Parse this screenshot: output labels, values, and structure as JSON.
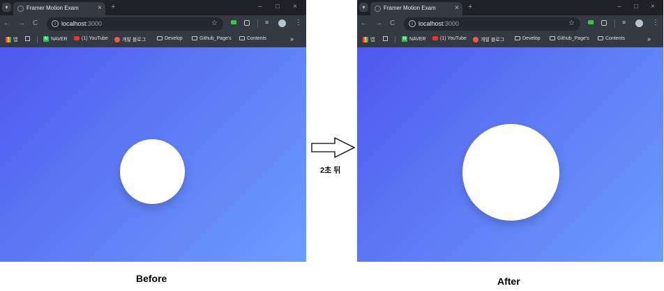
{
  "browser": {
    "tab_title": "Framer Motion Exam",
    "url_host": "localhost",
    "url_port": ":3000",
    "bookmarks": [
      "앱",
      "NAVER",
      "(1) YouTube",
      "개발 블로그",
      "Develop",
      "Github_Page's",
      "Contents"
    ],
    "more": "»"
  },
  "icons": {
    "tab_menu": "▾",
    "close": "×",
    "new_tab": "+",
    "minimize": "–",
    "maximize": "□",
    "back": "←",
    "forward": "→",
    "reload": "C",
    "info": "i",
    "star": "☆",
    "kebab": "⋮",
    "readlist": "≡"
  },
  "colors": {
    "gradient_start": "#4f58ef",
    "gradient_end": "#6c9cfe",
    "circle": "#ffffff"
  },
  "arrow_caption": "2초 뒤",
  "captions": {
    "before": "Before",
    "after": "After"
  }
}
